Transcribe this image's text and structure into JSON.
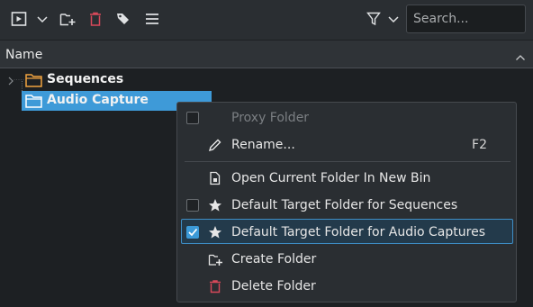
{
  "toolbar": {
    "search": {
      "placeholder": "Search..."
    },
    "icons": [
      "play-clip-icon",
      "chevron-down-icon",
      "new-folder-icon",
      "delete-icon",
      "tag-icon",
      "hamburger-menu-icon",
      "filter-icon",
      "chevron-down-icon"
    ]
  },
  "tree": {
    "column_header": "Name",
    "rows": [
      {
        "label": "Sequences",
        "expanded": false,
        "selected": false
      },
      {
        "label": "Audio Capture",
        "selected": true
      }
    ]
  },
  "context_menu": {
    "items": [
      {
        "label": "Proxy Folder",
        "checkbox": true,
        "checked": false,
        "disabled": true
      },
      {
        "label": "Rename...",
        "icon": "pencil-icon",
        "shortcut": "F2"
      },
      {
        "label": "Open Current Folder In New Bin",
        "icon": "open-in-bin-icon"
      },
      {
        "label": "Default Target Folder for Sequences",
        "icon": "star-icon",
        "checkbox": true,
        "checked": false
      },
      {
        "label": "Default Target Folder for Audio Captures",
        "icon": "star-icon",
        "checkbox": true,
        "checked": true
      },
      {
        "label": "Create Folder",
        "icon": "new-folder-icon"
      },
      {
        "label": "Delete Folder",
        "icon": "trash-icon"
      }
    ]
  },
  "colors": {
    "accent": "#3e9ad8",
    "folder": "#f1a340",
    "delete": "#d9495a"
  }
}
